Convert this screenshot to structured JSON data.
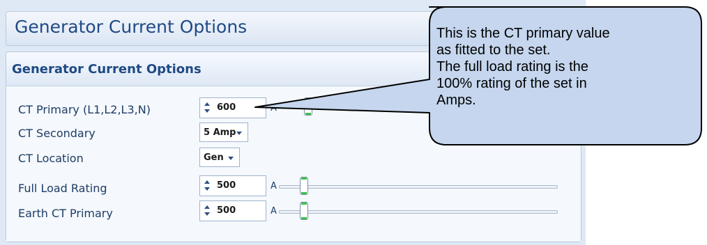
{
  "header": {
    "title": "Generator Current Options"
  },
  "panel": {
    "title": "Generator Current Options",
    "rows": [
      {
        "label": "CT Primary (L1,L2,L3,N)",
        "value": "600",
        "unit": "A"
      },
      {
        "label": "CT Secondary",
        "value": "5 Amp"
      },
      {
        "label": "CT Location",
        "value": "Gen"
      },
      {
        "label": "Full Load Rating",
        "value": "500",
        "unit": "A",
        "slider_fraction": 0.0
      },
      {
        "label": "Earth CT Primary",
        "value": "500",
        "unit": "A",
        "slider_fraction": 0.0
      }
    ]
  },
  "callout": {
    "lines": [
      "This is the CT primary value",
      "as fitted to the set.",
      "The full load rating is the",
      "100% rating of the set in",
      "Amps."
    ]
  },
  "colors": {
    "accent": "#1f4a84",
    "callout_fill": "#c5d6ee",
    "slider_grip": "#3ec24a"
  },
  "icons": {
    "spinner": "up-down-arrows",
    "dropdown": "chevron-down"
  }
}
